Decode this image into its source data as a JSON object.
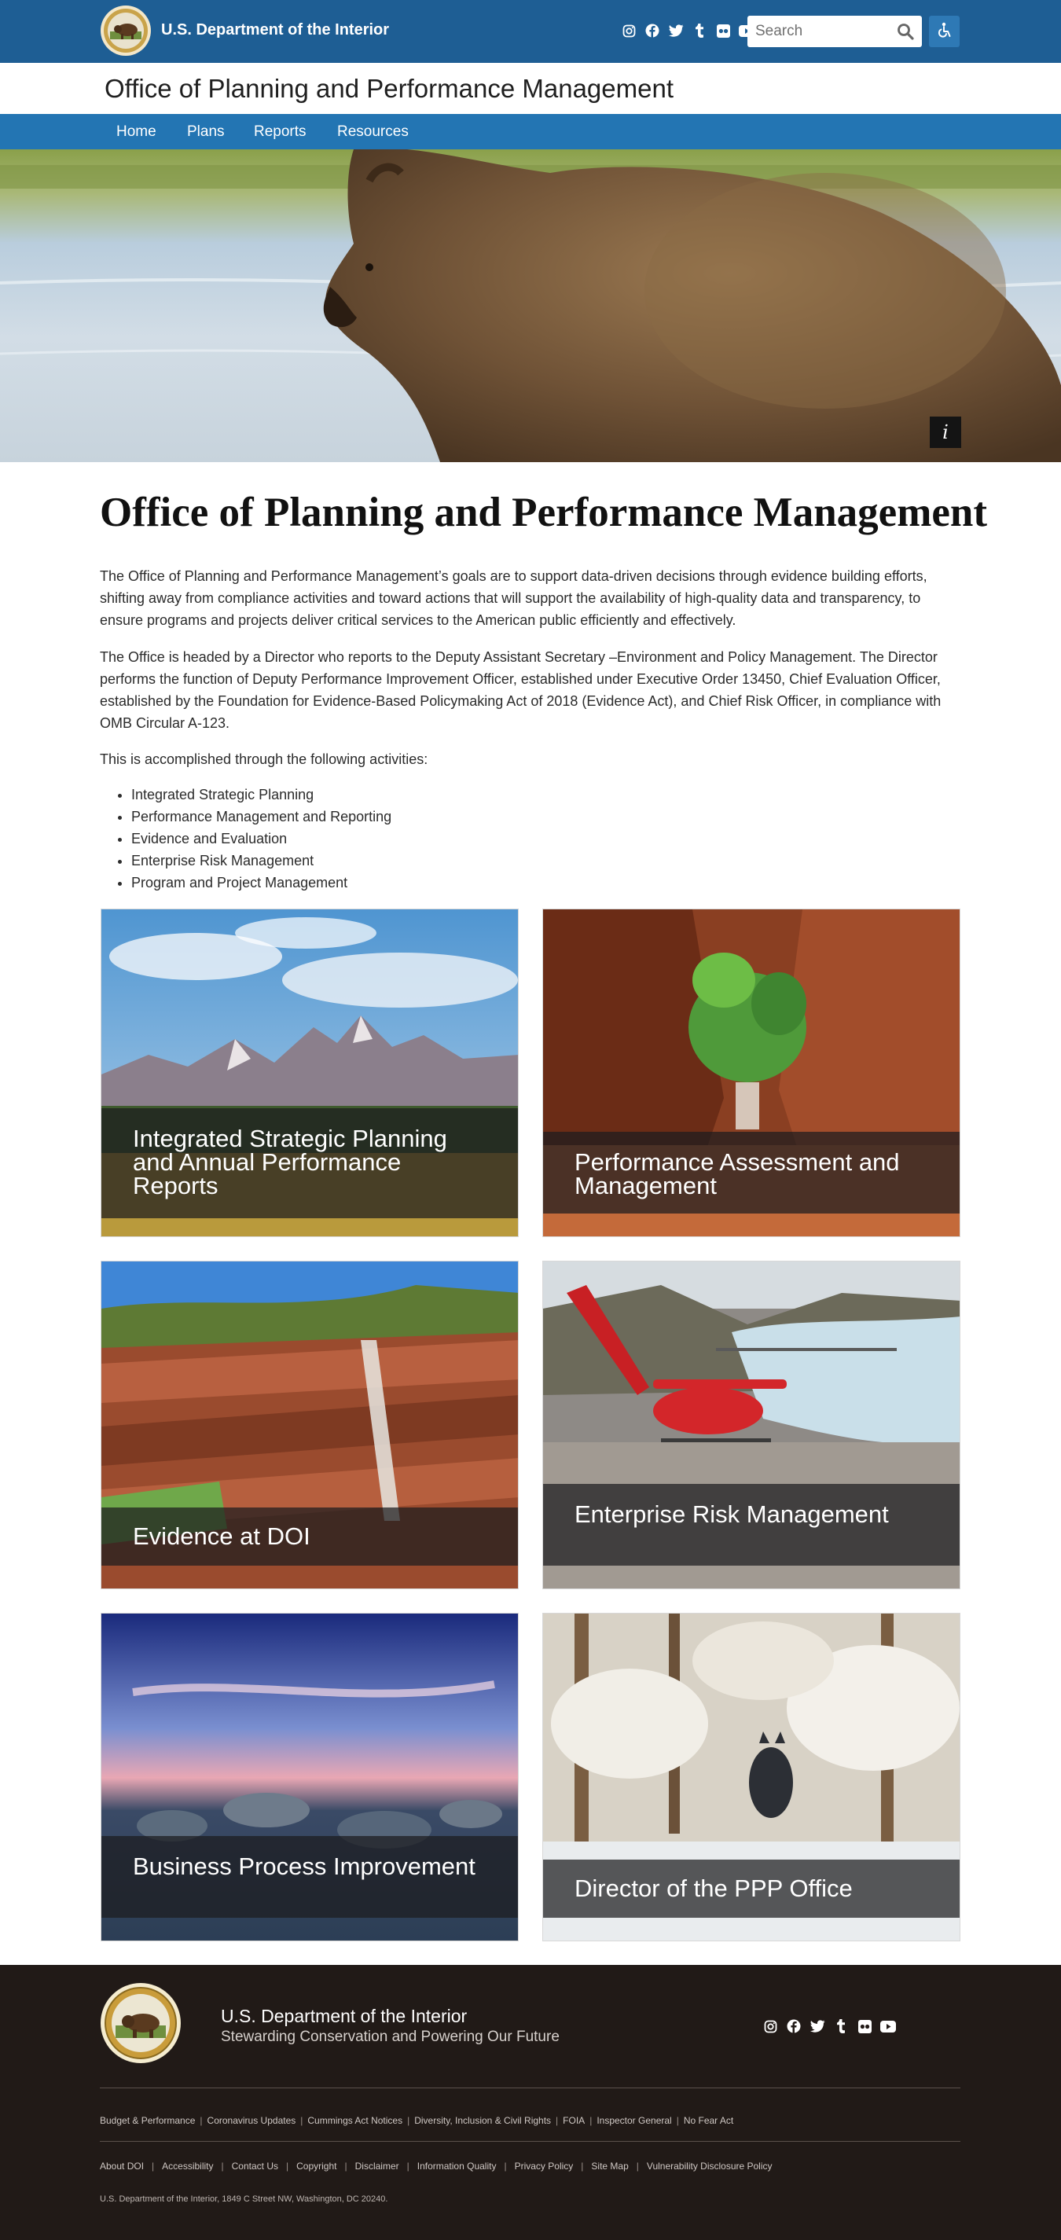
{
  "header": {
    "department": "U.S. Department of the Interior",
    "search_placeholder": "Search",
    "social_icons": [
      "instagram-icon",
      "facebook-icon",
      "twitter-icon",
      "tumblr-icon",
      "flickr-icon",
      "youtube-icon"
    ],
    "brand_color": "#1e5e94"
  },
  "office": {
    "title": "Office of Planning and Performance Management"
  },
  "nav": {
    "items": [
      "Home",
      "Plans",
      "Reports",
      "Resources"
    ],
    "color": "#2375b3"
  },
  "hero": {
    "info_label": "i"
  },
  "main": {
    "title": "Office of Planning and Performance Management",
    "paragraph1": "The Office of Planning and Performance Management’s goals are to support data-driven decisions through evidence building efforts, shifting away from compliance activities and toward actions that will support the availability of high-quality data and transparency, to ensure programs and projects deliver critical services to the American public efficiently and effectively.",
    "paragraph2": "The Office is headed by a Director who reports to the Deputy Assistant Secretary –Environment and Policy Management.  The Director performs the function of Deputy Performance Improvement Officer, established under Executive Order 13450, Chief Evaluation Officer, established by the Foundation for Evidence-Based Policymaking Act of 2018 (Evidence Act), and Chief Risk Officer, in compliance with OMB Circular A-123.",
    "paragraph3": "This is accomplished through the following activities:",
    "activities": [
      "Integrated Strategic Planning",
      "Performance Management and Reporting",
      "Evidence and Evaluation",
      "Enterprise Risk Management",
      "Program and Project Management"
    ]
  },
  "cards": [
    {
      "title": "Integrated Strategic Planning and Annual Performance Reports"
    },
    {
      "title": "Performance Assessment and Management"
    },
    {
      "title": "Evidence at DOI"
    },
    {
      "title": "Enterprise Risk Management"
    },
    {
      "title": "Business Process Improvement"
    },
    {
      "title": "Director of the PPP Office"
    }
  ],
  "footer": {
    "department": "U.S. Department of the Interior",
    "tagline": "Stewarding Conservation and Powering Our Future",
    "links_row1": [
      "Budget & Performance",
      "Coronavirus Updates",
      "Cummings Act Notices",
      "Diversity, Inclusion & Civil Rights",
      "FOIA",
      "Inspector General",
      "No Fear Act"
    ],
    "links_row2": [
      "About DOI",
      "Accessibility",
      "Contact Us",
      "Copyright",
      "Disclaimer",
      "Information Quality",
      "Privacy Policy",
      "Site Map",
      "Vulnerability Disclosure Policy"
    ],
    "address": "U.S. Department of the Interior, 1849 C Street NW, Washington, DC 20240.",
    "background_color": "#211a17"
  }
}
